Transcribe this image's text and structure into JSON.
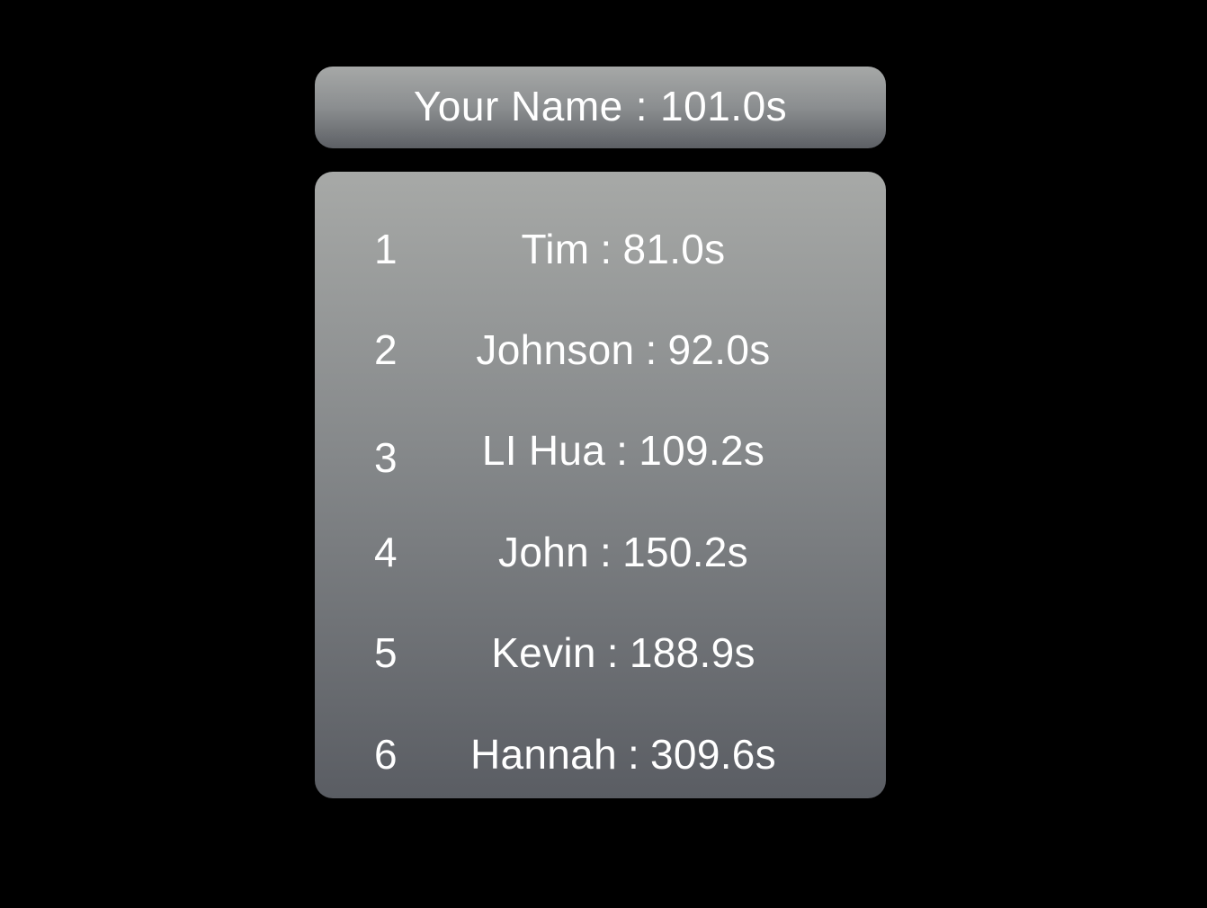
{
  "player": {
    "name": "Your Name",
    "separator": ":",
    "time": "101.0s"
  },
  "leaderboard": {
    "separator": ":",
    "entries": [
      {
        "rank": "1",
        "name": "Tim",
        "time": "81.0s"
      },
      {
        "rank": "2",
        "name": "Johnson",
        "time": "92.0s"
      },
      {
        "rank": "3",
        "name": "LI Hua",
        "time": "109.2s"
      },
      {
        "rank": "4",
        "name": "John",
        "time": "150.2s"
      },
      {
        "rank": "5",
        "name": "Kevin",
        "time": "188.9s"
      },
      {
        "rank": "6",
        "name": "Hannah",
        "time": "309.6s"
      }
    ]
  },
  "colors": {
    "background": "#000000",
    "panel_top": "#a6a8a7",
    "panel_bottom": "#5a5d63",
    "text": "#ffffff"
  }
}
